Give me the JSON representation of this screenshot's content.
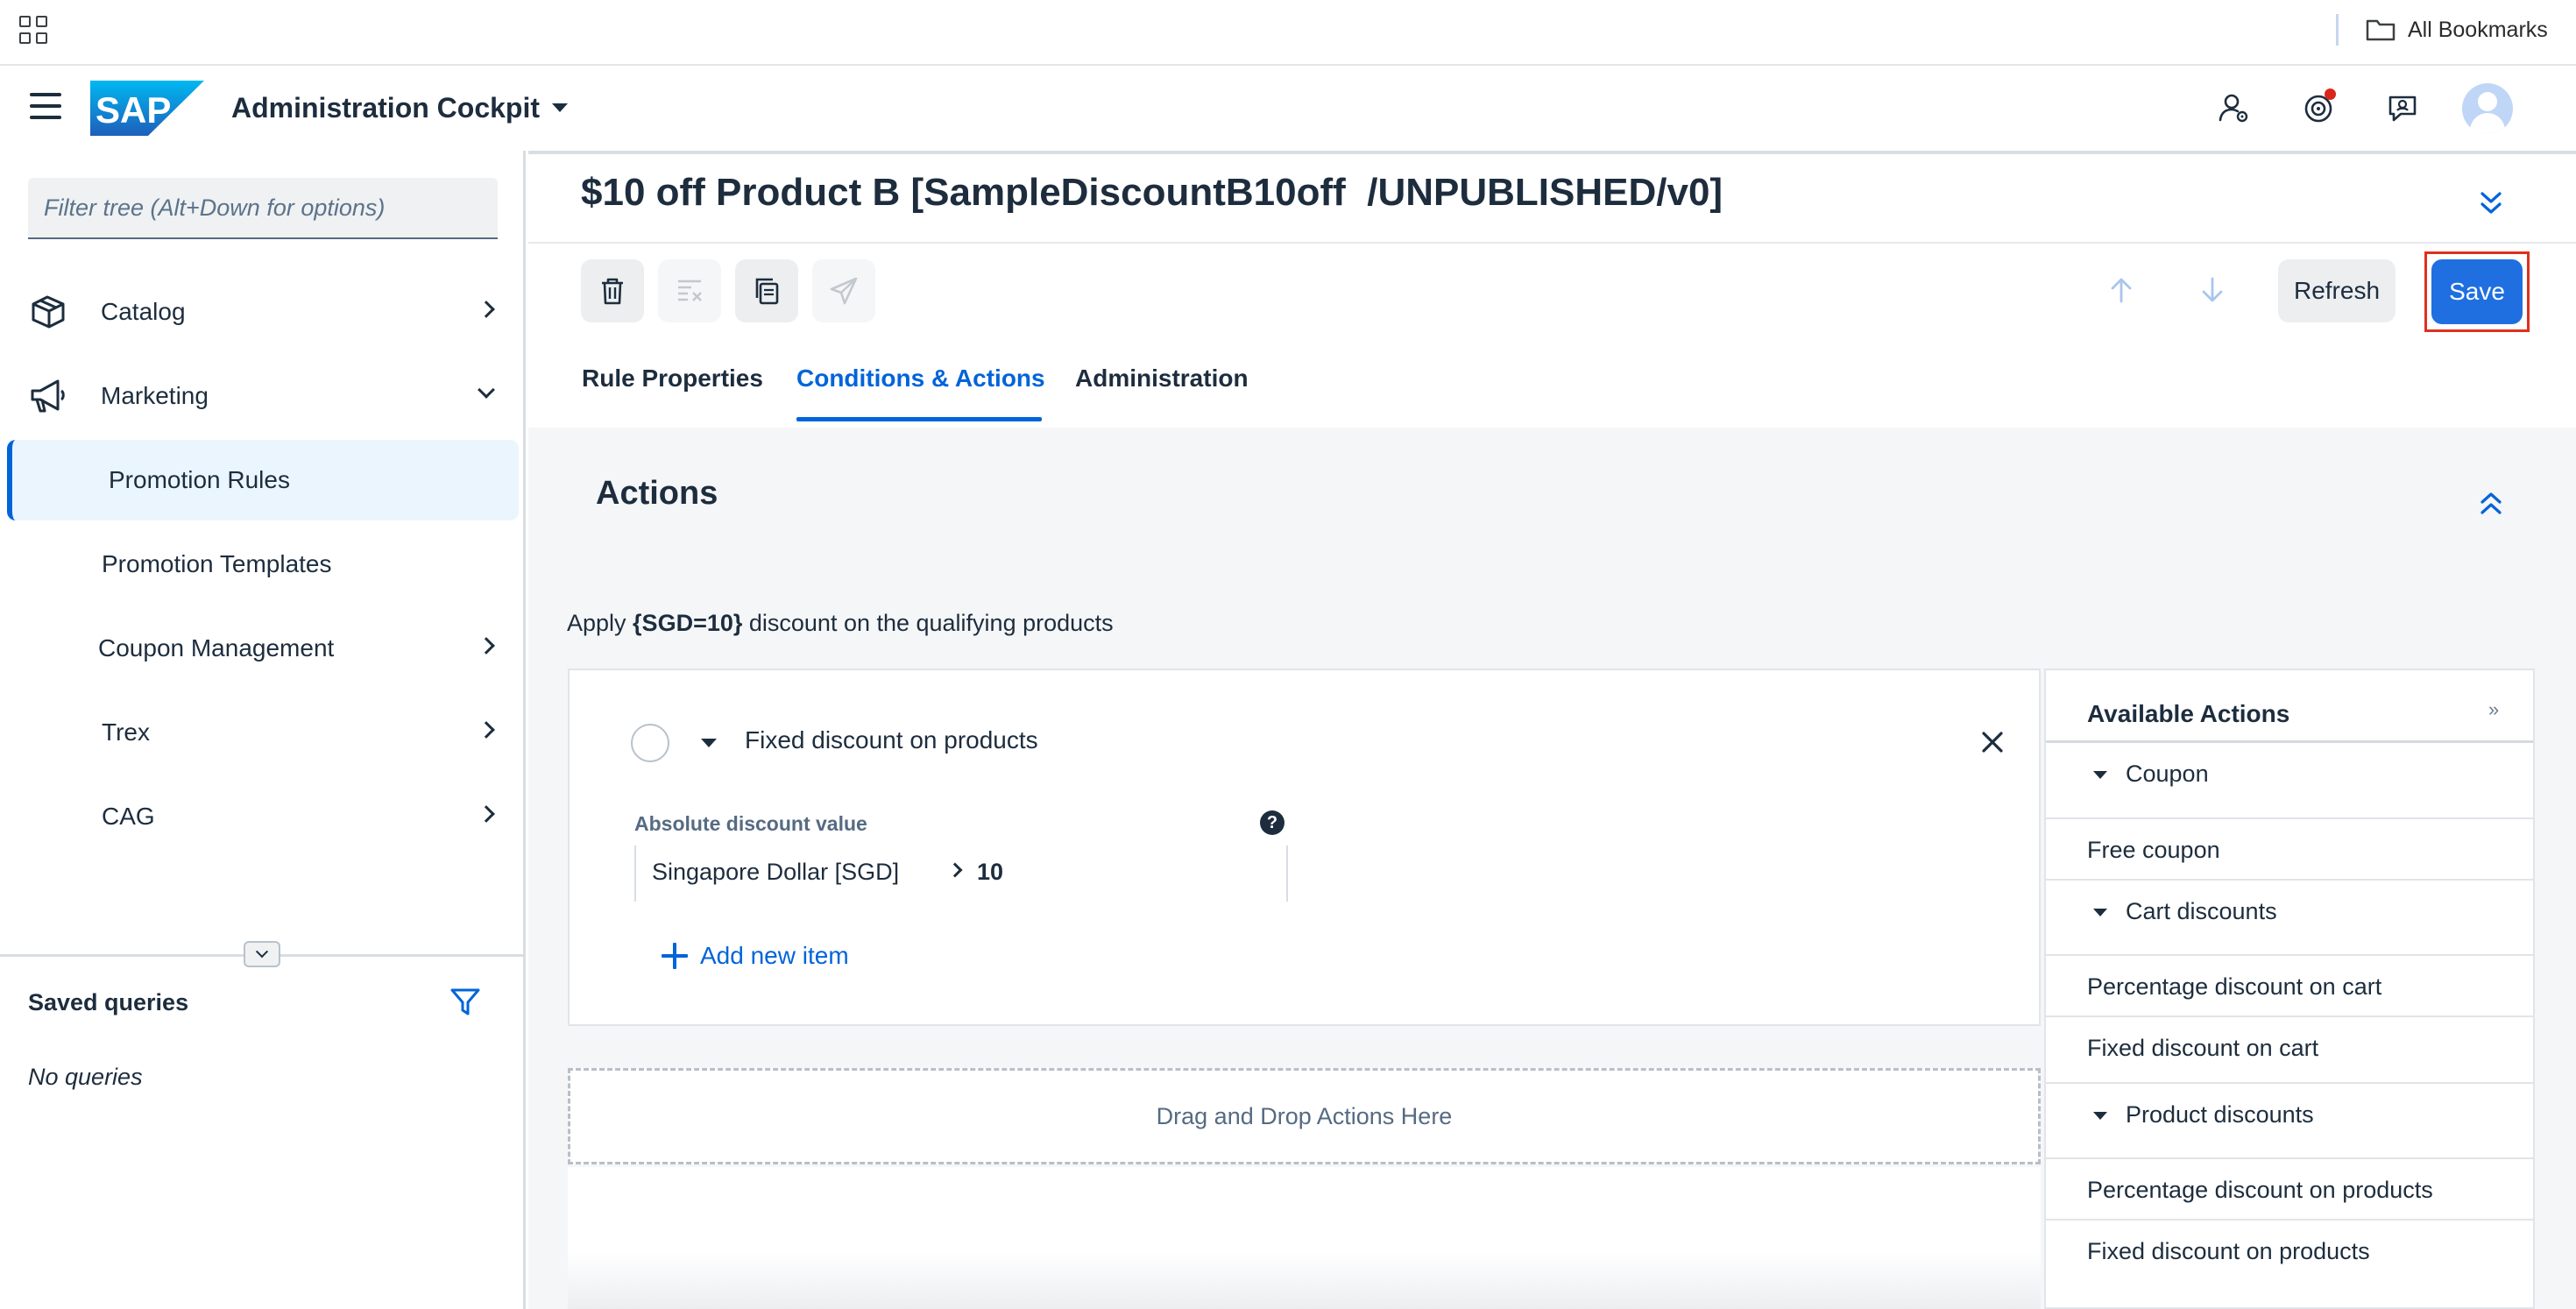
{
  "browser": {
    "bookmarks_label": "All Bookmarks"
  },
  "shell": {
    "app_title": "Administration Cockpit",
    "logo_text": "SAP",
    "colors": {
      "brand": "#0a6ed1",
      "notification": "#d9261c"
    }
  },
  "sidebar": {
    "filter_placeholder": "Filter tree (Alt+Down for options)",
    "items": [
      {
        "label": "Catalog",
        "icon": "catalog-icon",
        "state": "collapsed"
      },
      {
        "label": "Marketing",
        "icon": "megaphone-icon",
        "state": "expanded"
      },
      {
        "label": "Promotion Rules",
        "state": "selected"
      },
      {
        "label": "Promotion Templates"
      },
      {
        "label": "Coupon Management",
        "state": "collapsed"
      },
      {
        "label": "Trex",
        "state": "collapsed"
      },
      {
        "label": "CAG",
        "state": "collapsed"
      }
    ],
    "saved_queries_title": "Saved queries",
    "no_queries_text": "No queries"
  },
  "main": {
    "object_title": "$10 off Product B [SampleDiscountB10off  /UNPUBLISHED/v0]",
    "toolbar": {
      "refresh_label": "Refresh",
      "save_label": "Save"
    },
    "tabs": [
      {
        "label": "Rule Properties"
      },
      {
        "label": "Conditions & Actions",
        "selected": true
      },
      {
        "label": "Administration"
      }
    ],
    "actions_section": {
      "title": "Actions",
      "apply_prefix": "Apply ",
      "apply_value": "{SGD=10}",
      "apply_suffix": " discount on the qualifying products",
      "card": {
        "title": "Fixed discount on products",
        "field_label": "Absolute discount value",
        "currency": "Singapore Dollar [SGD]",
        "amount": "10",
        "add_item_label": "Add new item"
      },
      "drop_zone_label": "Drag and Drop Actions Here"
    },
    "available_actions": {
      "title": "Available Actions",
      "rows": [
        {
          "label": "Coupon",
          "group": true
        },
        {
          "label": "Free coupon"
        },
        {
          "label": "Cart discounts",
          "group": true
        },
        {
          "label": "Percentage discount on cart"
        },
        {
          "label": "Fixed discount on cart"
        },
        {
          "label": "Product discounts",
          "group": true
        },
        {
          "label": "Percentage discount on products"
        },
        {
          "label": "Fixed discount on products"
        }
      ]
    }
  }
}
